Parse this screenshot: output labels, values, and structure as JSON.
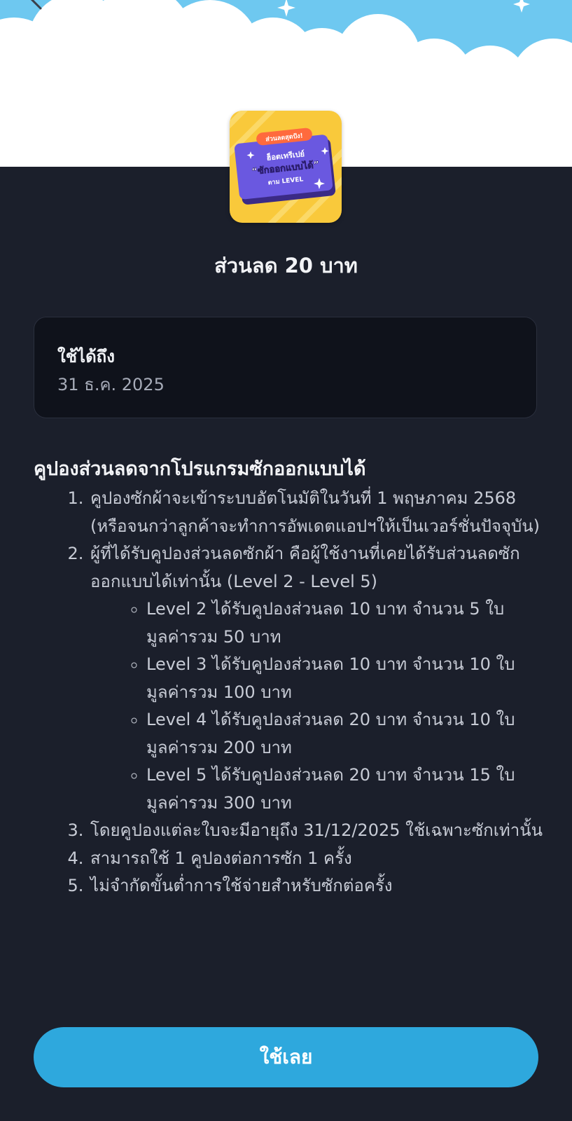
{
  "hero": {
    "back_icon": "chevron-left-icon",
    "sky_color": "#6ec8f0",
    "cloud_color": "#ffffff"
  },
  "coupon": {
    "badge_text": "ส่วนลดสุดปัง!",
    "line1": "ฮ็อตเทรีเปย์",
    "line2": "“ซักออกแบบได้”",
    "line3": "ตาม LEVEL"
  },
  "title": "ส่วนลด 20 บาท",
  "validity": {
    "label": "ใช้ได้ถึง",
    "date": "31 ธ.ค. 2025"
  },
  "terms": {
    "heading": "คูปองส่วนลดจากโปรแกรมซักออกแบบได้",
    "items": [
      {
        "text": "คูปองซักผ้าจะเข้าระบบอัตโนมัติในวันที่ 1 พฤษภาคม 2568 (หรือจนกว่าลูกค้าจะทำการอัพเดตแอปฯให้เป็นเวอร์ชั่นปัจจุบัน)"
      },
      {
        "text": "ผู้ที่ได้รับคูปองส่วนลดซักผ้า คือผู้ใช้งานที่เคยได้รับส่วนลดซักออกแบบได้เท่านั้น (Level 2 - Level 5)",
        "sub": [
          "Level 2 ได้รับคูปองส่วนลด 10 บาท จำนวน 5 ใบ มูลค่ารวม 50 บาท",
          "Level 3 ได้รับคูปองส่วนลด 10 บาท จำนวน 10 ใบ มูลค่ารวม 100 บาท",
          "Level 4 ได้รับคูปองส่วนลด 20 บาท จำนวน 10 ใบ มูลค่ารวม 200 บาท",
          "Level 5 ได้รับคูปองส่วนลด 20 บาท จำนวน 15 ใบ มูลค่ารวม 300 บาท"
        ]
      },
      {
        "text": "โดยคูปองแต่ละใบจะมีอายุถึง 31/12/2025 ใช้เฉพาะซักเท่านั้น"
      },
      {
        "text": "สามารถใช้ 1 คูปองต่อการซัก 1 ครั้ง"
      },
      {
        "text": "ไม่จำกัดขั้นต่ำการใช้จ่ายสำหรับซักต่อครั้ง"
      }
    ]
  },
  "button": {
    "label": "ใช้เลย",
    "color": "#2ea8dd"
  },
  "colors": {
    "background": "#1b1f2b",
    "card": "#0f121b"
  }
}
